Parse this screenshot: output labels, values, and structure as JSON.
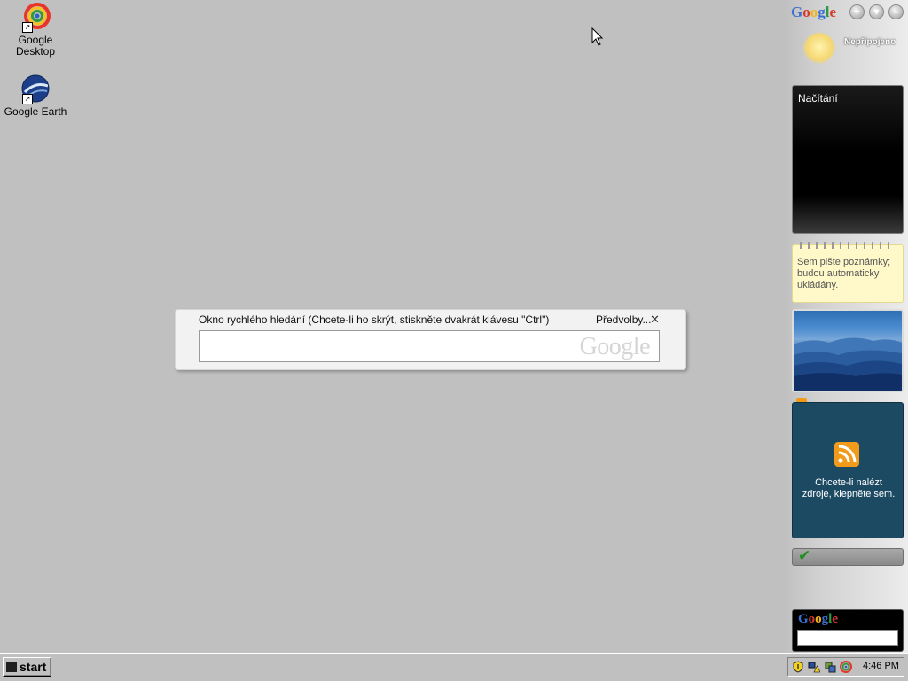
{
  "desktop": {
    "icons": [
      {
        "label": "Google Desktop"
      },
      {
        "label": "Google Earth"
      }
    ]
  },
  "quick_search": {
    "title": "Okno rychlého hledání (Chcete-li ho skrýt, stiskněte dvakrát klávesu \"Ctrl\")",
    "prefs_label": "Předvolby...",
    "close_glyph": "✕",
    "input_value": "",
    "watermark": "Google"
  },
  "sidebar": {
    "logo": "Google",
    "buttons": [
      "+",
      "▾",
      "–"
    ],
    "status": "Nepřipojeno",
    "loading_text": "Načítání",
    "notes_text": "Sem pište poznámky; budou automaticky ukládány.",
    "rss_text": "Chcete-li nalézt zdroje, klepněte sem.",
    "search_logo": "Google",
    "search_value": ""
  },
  "taskbar": {
    "start_label": "start",
    "clock": "4:46 PM"
  },
  "icons_semantic": [
    "google-desktop-icon",
    "google-earth-icon",
    "rss-icon",
    "checkmark-icon",
    "shield-icon",
    "network-warning-icon",
    "tray-app-icon",
    "google-desktop-tray-icon"
  ],
  "colors": {
    "desktop_bg": "#c0c0c0",
    "rss_gadget_bg": "#1c4a63",
    "notes_bg": "#fff8c8"
  }
}
